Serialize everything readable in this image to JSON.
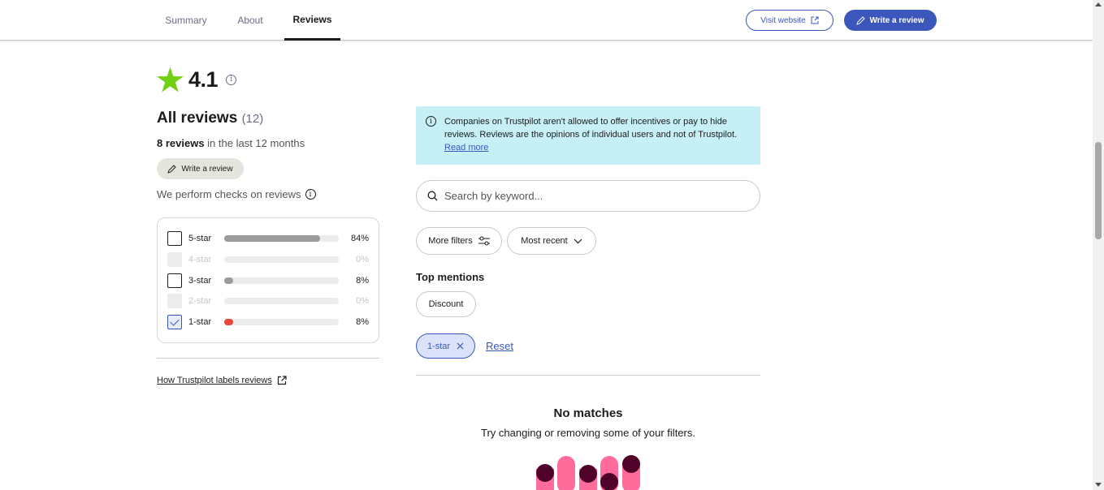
{
  "header": {
    "tabs": [
      {
        "label": "Summary",
        "active": false
      },
      {
        "label": "About",
        "active": false
      },
      {
        "label": "Reviews",
        "active": true
      }
    ],
    "visit_website_label": "Visit website",
    "write_review_label": "Write a review"
  },
  "summary": {
    "rating": "4.1",
    "all_reviews_label": "All reviews",
    "all_reviews_count": "(12)",
    "recent_count": "8 reviews",
    "recent_suffix": " in the last 12 months",
    "write_review_label": "Write a review",
    "checks_label": "We perform checks on reviews"
  },
  "star_filter": [
    {
      "label": "5-star",
      "percent_text": "84%",
      "percent": 84,
      "state": "unchecked",
      "color": "#9b9b9b"
    },
    {
      "label": "4-star",
      "percent_text": "0%",
      "percent": 0,
      "state": "disabled",
      "color": "#ececec"
    },
    {
      "label": "3-star",
      "percent_text": "8%",
      "percent": 8,
      "state": "unchecked",
      "color": "#9b9b9b"
    },
    {
      "label": "2-star",
      "percent_text": "0%",
      "percent": 0,
      "state": "disabled",
      "color": "#ececec"
    },
    {
      "label": "1-star",
      "percent_text": "8%",
      "percent": 8,
      "state": "checked",
      "color": "#e8453c"
    }
  ],
  "labels_link": "How Trustpilot labels reviews",
  "notice": {
    "text": "Companies on Trustpilot aren't allowed to offer incentives or pay to hide reviews. Reviews are the opinions of individual users and not of Trustpilot. ",
    "link": "Read more"
  },
  "search": {
    "placeholder": "Search by keyword..."
  },
  "filters": {
    "more_filters": "More filters",
    "sort": "Most recent"
  },
  "top_mentions": {
    "title": "Top mentions",
    "items": [
      "Discount"
    ]
  },
  "active_filter": {
    "label": "1-star",
    "reset": "Reset"
  },
  "empty_state": {
    "title": "No matches",
    "subtitle": "Try changing or removing some of your filters."
  },
  "colors": {
    "brand_blue": "#3c57bc",
    "star_green": "#73cf11",
    "notice_bg": "#c6f0f5",
    "illustration_pink": "#ff6c9c",
    "illustration_dark": "#51022a"
  }
}
